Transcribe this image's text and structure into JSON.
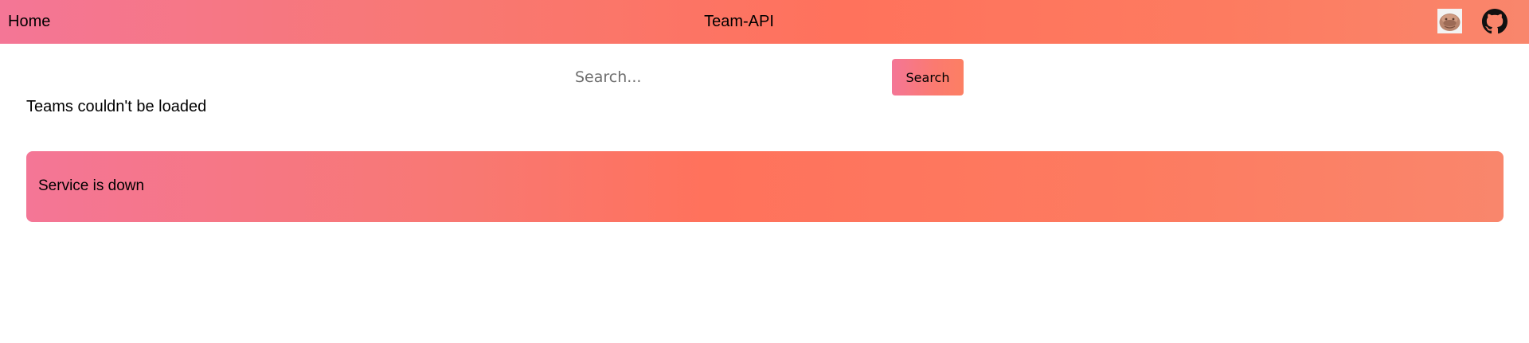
{
  "navbar": {
    "home_label": "Home",
    "title": "Team-API",
    "avatar_icon": "avatar-icon",
    "github_icon": "github-icon",
    "gradient_colors": [
      "#f47696",
      "#ff725c",
      "#f9866c"
    ]
  },
  "search": {
    "placeholder": "Search...",
    "value": "",
    "button_label": "Search"
  },
  "status": {
    "message": "Teams couldn't be loaded"
  },
  "alert": {
    "message": "Service is down",
    "color": "#ff725c"
  }
}
